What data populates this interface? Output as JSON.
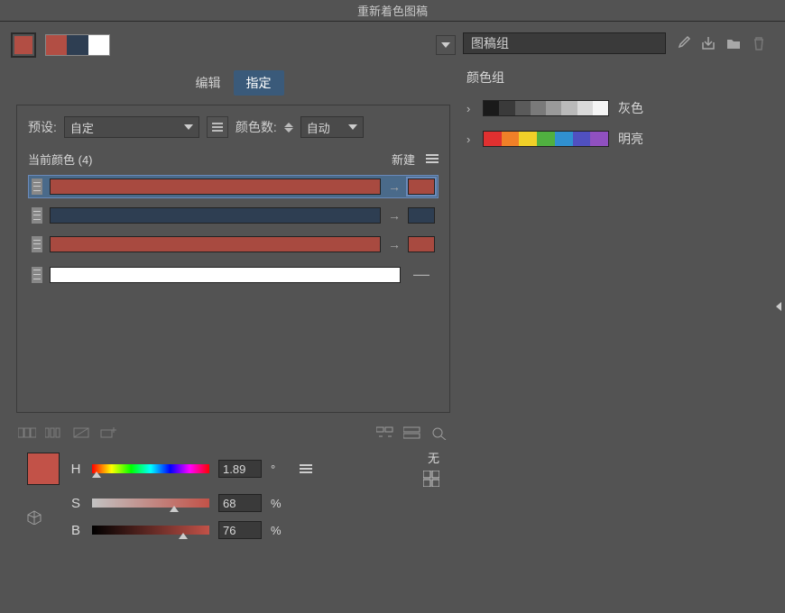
{
  "title": "重新着色图稿",
  "swatch_color": "#b24e44",
  "tri_colors": [
    "#b24e44",
    "#2e3e52",
    "#ffffff"
  ],
  "tabs": {
    "edit": "编辑",
    "assign": "指定"
  },
  "preset": {
    "label": "预设:",
    "value": "自定"
  },
  "color_count": {
    "label": "颜色数:",
    "value": "自动"
  },
  "current_colors": {
    "label": "当前颜色 (4)",
    "new_label": "新建"
  },
  "rows": [
    {
      "color": "#a84a40",
      "target": "#a84a40",
      "selected": true
    },
    {
      "color": "#2e3e52",
      "target": "#2e3e52",
      "selected": false
    },
    {
      "color": "#a84a40",
      "target": "#a84a40",
      "selected": false
    },
    {
      "color": "#ffffff",
      "target": null,
      "selected": false
    }
  ],
  "hsb": {
    "none": "无",
    "H": {
      "label": "H",
      "value": "1.89",
      "unit": "°"
    },
    "S": {
      "label": "S",
      "value": "68",
      "unit": "%"
    },
    "B": {
      "label": "B",
      "value": "76",
      "unit": "%"
    },
    "preview": "#c25248"
  },
  "right": {
    "input_value": "图稿组",
    "section": "颜色组",
    "groups": [
      {
        "name": "灰色",
        "colors": [
          "#1a1a1a",
          "#3a3a3a",
          "#5a5a5a",
          "#7a7a7a",
          "#9a9a9a",
          "#bababa",
          "#dadada",
          "#f5f5f5"
        ]
      },
      {
        "name": "明亮",
        "colors": [
          "#e03030",
          "#f08028",
          "#f0d028",
          "#50b040",
          "#3090d0",
          "#5050c0",
          "#9050c0"
        ]
      }
    ]
  }
}
